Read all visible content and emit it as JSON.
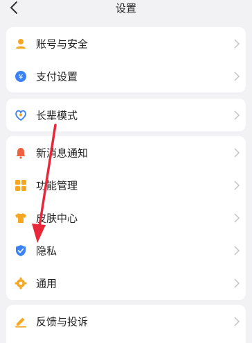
{
  "header": {
    "title": "设置"
  },
  "groups": [
    {
      "items": [
        {
          "label": "账号与安全",
          "icon": "user-icon"
        },
        {
          "label": "支付设置",
          "icon": "yen-icon"
        }
      ]
    },
    {
      "items": [
        {
          "label": "长辈模式",
          "icon": "heart-badge-icon"
        }
      ]
    },
    {
      "items": [
        {
          "label": "新消息通知",
          "icon": "bell-icon"
        },
        {
          "label": "功能管理",
          "icon": "grid-icon"
        },
        {
          "label": "皮肤中心",
          "icon": "shirt-icon"
        },
        {
          "label": "隐私",
          "icon": "shield-check-icon"
        },
        {
          "label": "通用",
          "icon": "gear-icon"
        }
      ]
    },
    {
      "items": [
        {
          "label": "反馈与投诉",
          "icon": "pencil-icon"
        }
      ]
    }
  ],
  "colors": {
    "accent_orange": "#f5a623",
    "accent_blue": "#3b82f6",
    "arrow_red": "#e8283a"
  }
}
